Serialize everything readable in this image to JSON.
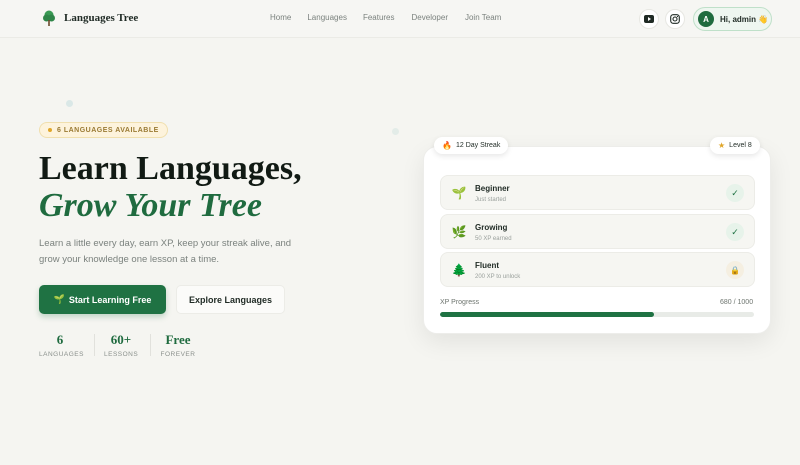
{
  "header": {
    "brand": "Languages Tree",
    "nav": [
      "Home",
      "Languages",
      "Features",
      "Developer",
      "Join Team"
    ],
    "social": [
      "youtube-icon",
      "instagram-icon"
    ],
    "user": {
      "avatar_letter": "A",
      "greeting": "Hi, admin 👋"
    }
  },
  "hero": {
    "badge": "6 LANGUAGES AVAILABLE",
    "title_line1": "Learn Languages,",
    "title_line2": "Grow Your Tree",
    "description": "Learn a little every day, earn XP, keep your streak alive, and grow your knowledge one lesson at a time.",
    "primary_cta": "Start Learning Free",
    "secondary_cta": "Explore Languages",
    "stats": [
      {
        "value": "6",
        "label": "LANGUAGES"
      },
      {
        "value": "60+",
        "label": "LESSONS"
      },
      {
        "value": "Free",
        "label": "FOREVER"
      }
    ]
  },
  "card": {
    "streak": "12 Day Streak",
    "level": "Level 8",
    "levels": [
      {
        "name": "Beginner",
        "sub": "Just started",
        "icon": "🌱",
        "status": "done"
      },
      {
        "name": "Growing",
        "sub": "50 XP earned",
        "icon": "🌿",
        "status": "done"
      },
      {
        "name": "Fluent",
        "sub": "200 XP to unlock",
        "icon": "🌲",
        "status": "locked"
      }
    ],
    "xp_label": "XP Progress",
    "xp_value": "680 / 1000",
    "xp_fraction": 0.68
  },
  "colors": {
    "brand": "#1f7243",
    "accent": "#e0a62a"
  }
}
